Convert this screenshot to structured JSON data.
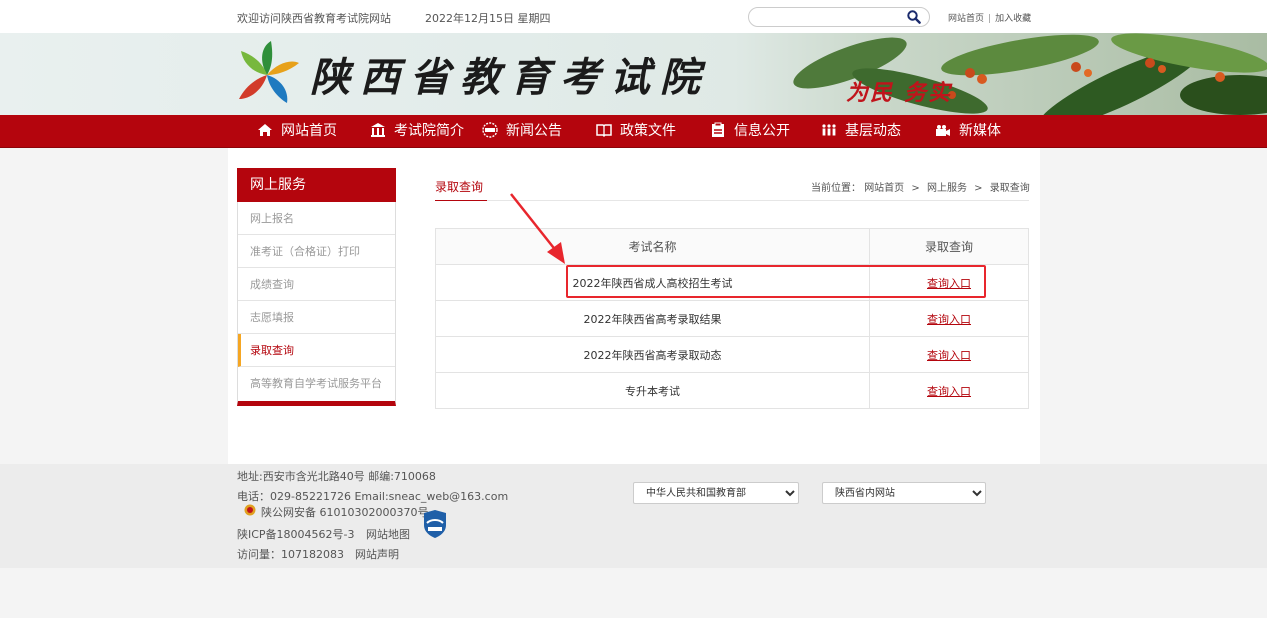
{
  "topbar": {
    "welcome": "欢迎访问陕西省教育考试院网站",
    "date": "2022年12月15日 星期四",
    "search_placeholder": "",
    "link_home": "网站首页",
    "link_separator": "|",
    "link_favorite": "加入收藏"
  },
  "banner": {
    "title": "陕西省教育考试院",
    "slogan_1": "为民",
    "slogan_2": "务实"
  },
  "nav": {
    "items": [
      {
        "label": "网站首页",
        "icon": "home-icon"
      },
      {
        "label": "考试院简介",
        "icon": "building-icon"
      },
      {
        "label": "新闻公告",
        "icon": "news-icon"
      },
      {
        "label": "政策文件",
        "icon": "book-icon"
      },
      {
        "label": "信息公开",
        "icon": "clipboard-icon"
      },
      {
        "label": "基层动态",
        "icon": "people-icon"
      },
      {
        "label": "新媒体",
        "icon": "camera-icon"
      }
    ]
  },
  "sidebar": {
    "heading": "网上服务",
    "items": [
      {
        "label": "网上报名"
      },
      {
        "label": "准考证（合格证）打印"
      },
      {
        "label": "成绩查询"
      },
      {
        "label": "志愿填报"
      },
      {
        "label": "录取查询",
        "active": true
      },
      {
        "label": "高等教育自学考试服务平台"
      }
    ]
  },
  "content": {
    "title": "录取查询",
    "breadcrumb": {
      "prefix": "当前位置：",
      "home": "网站首页",
      "sep": ">",
      "section": "网上服务",
      "current": "录取查询"
    },
    "table": {
      "col_name": "考试名称",
      "col_query": "录取查询",
      "rows": [
        {
          "name": "2022年陕西省成人高校招生考试",
          "link": "查询入口"
        },
        {
          "name": "2022年陕西省高考录取结果",
          "link": "查询入口"
        },
        {
          "name": "2022年陕西省高考录取动态",
          "link": "查询入口"
        },
        {
          "name": "专升本考试",
          "link": "查询入口"
        }
      ]
    }
  },
  "footer": {
    "address": "地址:西安市含光北路40号   邮编:710068",
    "contact": "电话：029-85221726   Email:sneac_web@163.com",
    "police": "陕公网安备 61010302000370号",
    "icp": "陕ICP备18004562号-3",
    "sitemap": "网站地图",
    "visits": "访问量：107182083",
    "statement": "网站声明",
    "select_1": "中华人民共和国教育部",
    "select_2": "陕西省内网站"
  },
  "colors": {
    "brand_red": "#b4050d",
    "highlight_red": "#e8262d",
    "active_marker": "#f5a623"
  }
}
